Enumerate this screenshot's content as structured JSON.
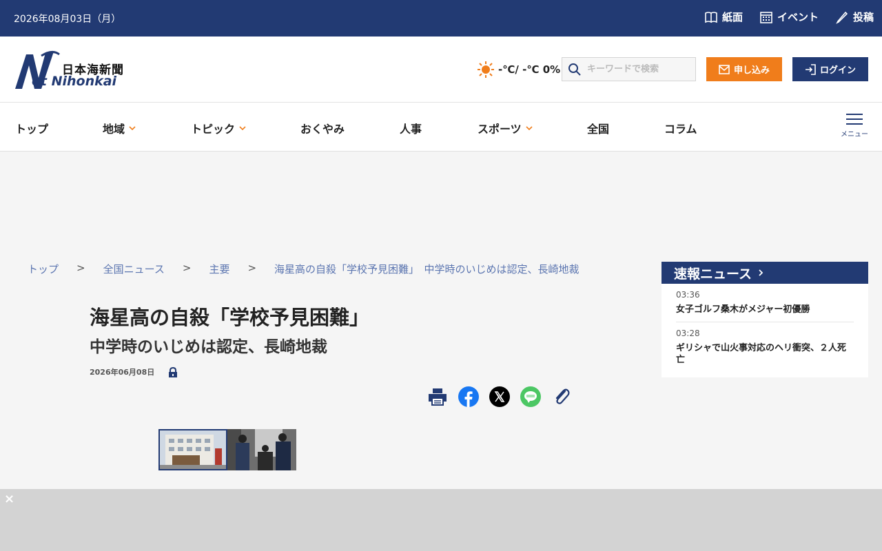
{
  "topbar": {
    "date": "2026年08月03日（月）",
    "links": [
      {
        "label": "紙面",
        "icon": "book-icon"
      },
      {
        "label": "イベント",
        "icon": "calendar-icon"
      },
      {
        "label": "投稿",
        "icon": "pencil-icon"
      }
    ]
  },
  "header": {
    "logo_jp": "日本海新聞",
    "logo_en": "et Nihonkai",
    "logo_mark": "N",
    "weather": "-℃/ -℃ 0%",
    "search_placeholder": "キーワードで検索",
    "apply_label": "申し込み",
    "login_label": "ログイン"
  },
  "nav": {
    "items": [
      {
        "label": "トップ"
      },
      {
        "label": "地域"
      },
      {
        "label": "トピック"
      },
      {
        "label": "おくやみ"
      },
      {
        "label": "人事"
      },
      {
        "label": "スポーツ"
      },
      {
        "label": "全国"
      },
      {
        "label": "コラム"
      }
    ],
    "menu_label": "メニュー"
  },
  "breadcrumb": {
    "items": [
      "トップ",
      "全国ニュース",
      "主要",
      "海星高の自殺「学校予見困難」　中学時のいじめは認定、長崎地裁"
    ],
    "separator": ">"
  },
  "article": {
    "title": "海星高の自殺「学校予見困難」",
    "subtitle": "中学時のいじめは認定、長崎地裁",
    "date": "2026年06月08日"
  },
  "sidebar": {
    "heading": "速報ニュース",
    "items": [
      {
        "time": "03:36",
        "title": "女子ゴルフ桑木がメジャー初優勝"
      },
      {
        "time": "03:28",
        "title": "ギリシャで山火事対応のヘリ衝突、２人死亡"
      }
    ]
  },
  "ad": {
    "close_label": "×"
  },
  "colors": {
    "navy": "#223a73",
    "orange": "#f07d1b"
  }
}
